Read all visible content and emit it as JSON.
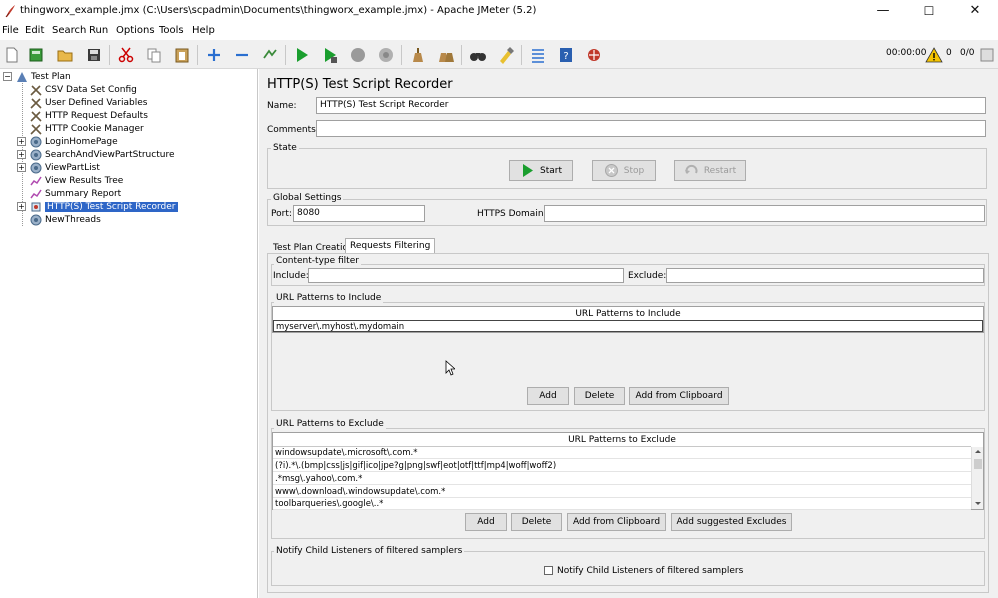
{
  "window": {
    "title": "thingworx_example.jmx (C:\\Users\\scpadmin\\Documents\\thingworx_example.jmx) - Apache JMeter (5.2)",
    "minimize": "—",
    "maximize": "☐",
    "close": "✕"
  },
  "menu": [
    "File",
    "Edit",
    "Search",
    "Run",
    "Options",
    "Tools",
    "Help"
  ],
  "toolbar": {
    "icons": [
      "new-icon",
      "templates-icon",
      "open-icon",
      "save-icon",
      "cut-icon",
      "copy-icon",
      "paste-icon",
      "expand-icon",
      "collapse-icon",
      "toggle-icon",
      "start-icon",
      "start-no-pauses-icon",
      "stop-icon",
      "shutdown-icon",
      "clear-icon",
      "clear-all-icon",
      "search-icon",
      "reset-search-icon",
      "function-helper-icon",
      "help-icon",
      "remote-icon"
    ],
    "timer": "00:00:00",
    "warnings": "0",
    "threads": "0/0"
  },
  "tree": [
    {
      "label": "Test Plan"
    },
    {
      "label": "CSV Data Set Config"
    },
    {
      "label": "User Defined Variables"
    },
    {
      "label": "HTTP Request Defaults"
    },
    {
      "label": "HTTP Cookie Manager"
    },
    {
      "label": "LoginHomePage"
    },
    {
      "label": "SearchAndViewPartStructure"
    },
    {
      "label": "ViewPartList"
    },
    {
      "label": "View Results Tree"
    },
    {
      "label": "Summary Report"
    },
    {
      "label": "HTTP(S) Test Script Recorder"
    },
    {
      "label": "NewThreads"
    }
  ],
  "panel": {
    "title": "HTTP(S) Test Script Recorder",
    "name_label": "Name:",
    "name_value": "HTTP(S) Test Script Recorder",
    "comments_label": "Comments:",
    "comments_value": "",
    "state_label": "State",
    "start": "Start",
    "stop": "Stop",
    "restart": "Restart",
    "global_label": "Global Settings",
    "port_label": "Port:",
    "port_value": "8080",
    "https_label": "HTTPS Domains:",
    "https_value": "",
    "tabs": [
      "Test Plan Creation",
      "Requests Filtering"
    ],
    "content_filter_label": "Content-type filter",
    "include_label": "Include:",
    "include_value": "",
    "exclude_label": "Exclude:",
    "exclude_value": "",
    "include_section": "URL Patterns to Include",
    "include_header": "URL Patterns to Include",
    "include_rows": [
      "myserver\\.myhost\\.mydomain"
    ],
    "include_buttons": [
      "Add",
      "Delete",
      "Add from Clipboard"
    ],
    "exclude_section": "URL Patterns to Exclude",
    "exclude_header": "URL Patterns to Exclude",
    "exclude_rows": [
      "windowsupdate\\.microsoft\\.com.*",
      "(?i).*\\.(bmp|css|js|gif|ico|jpe?g|png|swf|eot|otf|ttf|mp4|woff|woff2)",
      ".*msg\\.yahoo\\.com.*",
      "www\\.download\\.windowsupdate\\.com.*",
      "toolbarqueries\\.google\\..*"
    ],
    "exclude_buttons": [
      "Add",
      "Delete",
      "Add from Clipboard",
      "Add suggested Excludes"
    ],
    "notify_section": "Notify Child Listeners of filtered samplers",
    "notify_checkbox": "Notify Child Listeners of filtered samplers"
  },
  "colors": {
    "selection": "#2e66c7",
    "panel_bg": "#f0f0f0",
    "start_green": "#1a9e2e"
  }
}
